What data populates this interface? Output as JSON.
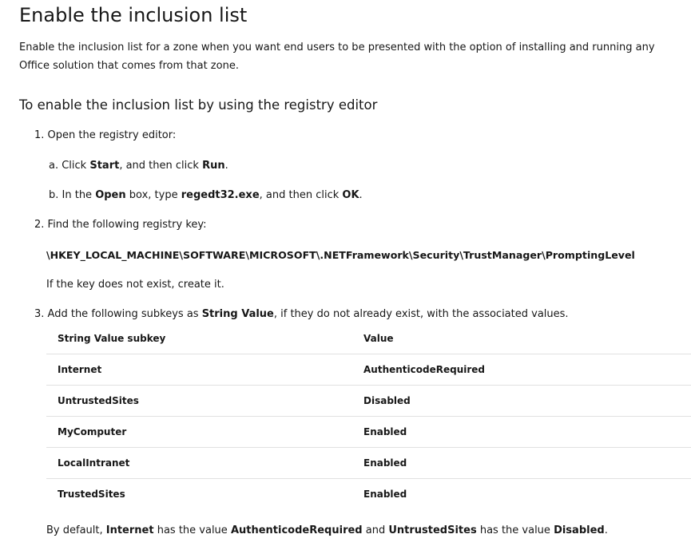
{
  "title": "Enable the inclusion list",
  "intro": "Enable the inclusion list for a zone when you want end users to be presented with the option of installing and running any Office solution that comes from that zone.",
  "subheading": "To enable the inclusion list by using the registry editor",
  "steps": {
    "s1": {
      "prefix": "1. ",
      "text": "Open the registry editor:"
    },
    "s1a": {
      "p1": "a. Click ",
      "b1": "Start",
      "p2": ", and then click ",
      "b2": "Run",
      "p3": "."
    },
    "s1b": {
      "p1": "b. In the ",
      "b1": "Open",
      "p2": " box, type ",
      "b2": "regedt32.exe",
      "p3": ", and then click ",
      "b3": "OK",
      "p4": "."
    },
    "s2": {
      "prefix": "2. ",
      "text": "Find the following registry key:"
    },
    "regkey": "\\HKEY_LOCAL_MACHINE\\SOFTWARE\\MICROSOFT\\.NETFramework\\Security\\TrustManager\\PromptingLevel",
    "note": "If the key does not exist, create it.",
    "s3": {
      "prefix": "3. ",
      "p1": "Add the following subkeys as ",
      "b1": "String Value",
      "p2": ", if they do not already exist, with the associated values."
    }
  },
  "table": {
    "headers": [
      "String Value subkey",
      "Value"
    ],
    "rows": [
      [
        "Internet",
        "AuthenticodeRequired"
      ],
      [
        "UntrustedSites",
        "Disabled"
      ],
      [
        "MyComputer",
        "Enabled"
      ],
      [
        "LocalIntranet",
        "Enabled"
      ],
      [
        "TrustedSites",
        "Enabled"
      ]
    ]
  },
  "footer": {
    "p1": "By default, ",
    "b1": "Internet",
    "p2": " has the value ",
    "b2": "AuthenticodeRequired",
    "p3": " and ",
    "b3": "UntrustedSites",
    "p4": " has the value ",
    "b4": "Disabled",
    "p5": "."
  }
}
